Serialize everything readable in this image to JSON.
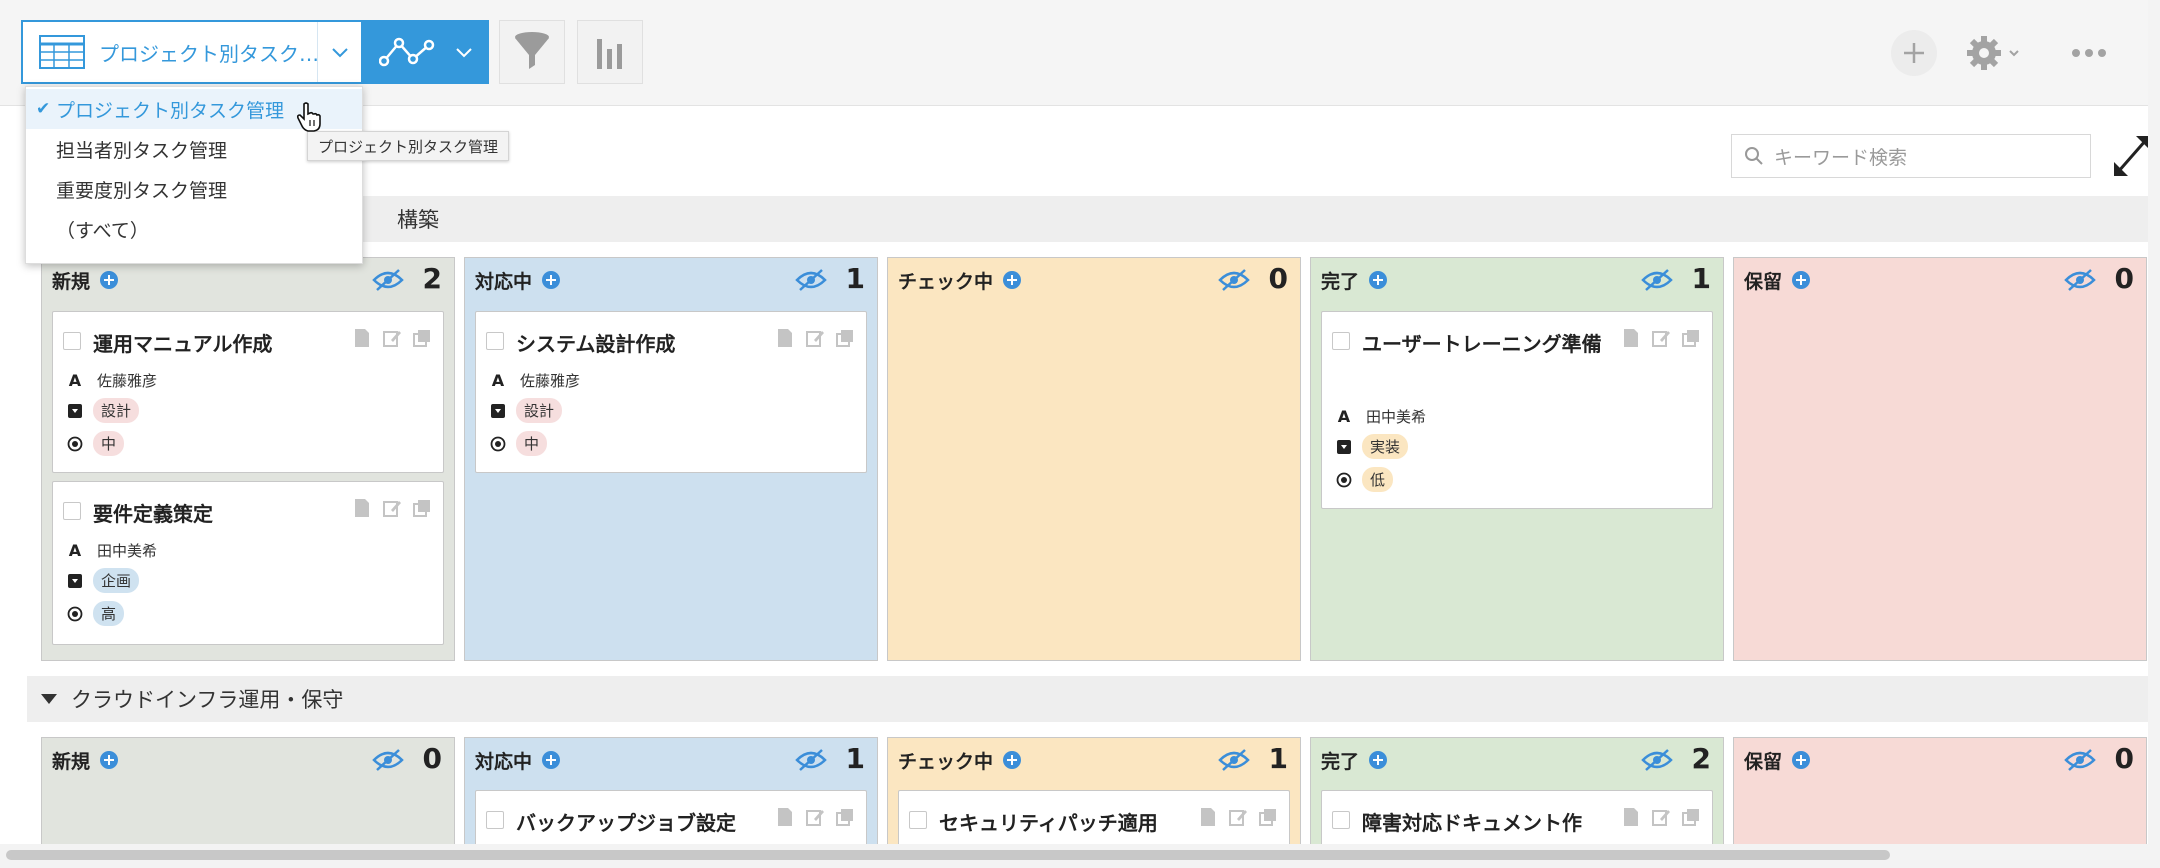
{
  "toolbar": {
    "view_label": "プロジェクト別タスク…",
    "icons": [
      "table-icon",
      "chevron-down-icon",
      "graph-icon",
      "filter-icon",
      "bar-chart-icon",
      "plus-icon",
      "gear-icon",
      "more-icon"
    ]
  },
  "dropdown": {
    "items": [
      {
        "label": "プロジェクト別タスク管理",
        "selected": true
      },
      {
        "label": "担当者別タスク管理",
        "selected": false
      },
      {
        "label": "重要度別タスク管理",
        "selected": false
      },
      {
        "label": "（すべて）",
        "selected": false
      }
    ],
    "tooltip": "プロジェクト別タスク管理"
  },
  "search": {
    "placeholder": "キーワード検索"
  },
  "groups": [
    {
      "title": "構築",
      "columns": [
        {
          "title": "新規",
          "count": "2",
          "color": "#e1e4de",
          "cards": [
            {
              "title": "運用マニュアル作成",
              "assignee": "佐藤雅彦",
              "category": "設計",
              "category_color": "#f6dede",
              "priority": "中",
              "priority_color": "#f6dede"
            },
            {
              "title": "要件定義策定",
              "assignee": "田中美希",
              "category": "企画",
              "category_color": "#cfe2f0",
              "priority": "高",
              "priority_color": "#cfe2f0"
            }
          ]
        },
        {
          "title": "対応中",
          "count": "1",
          "color": "#cde0ef",
          "cards": [
            {
              "title": "システム設計作成",
              "assignee": "佐藤雅彦",
              "category": "設計",
              "category_color": "#f6dede",
              "priority": "中",
              "priority_color": "#f6dede"
            }
          ]
        },
        {
          "title": "チェック中",
          "count": "0",
          "color": "#fbe6c1",
          "cards": []
        },
        {
          "title": "完了",
          "count": "1",
          "color": "#d9e8d3",
          "cards": [
            {
              "title": "ユーザートレーニング準備",
              "assignee": "田中美希",
              "category": "実装",
              "category_color": "#fbe6c1",
              "priority": "低",
              "priority_color": "#fbe6c1"
            }
          ]
        },
        {
          "title": "保留",
          "count": "0",
          "color": "#f7dad6",
          "cards": []
        }
      ]
    },
    {
      "title": "クラウドインフラ運用・保守",
      "columns": [
        {
          "title": "新規",
          "count": "0",
          "color": "#e1e4de",
          "cards": []
        },
        {
          "title": "対応中",
          "count": "1",
          "color": "#cde0ef",
          "cards": [
            {
              "title": "バックアップジョブ設定"
            }
          ]
        },
        {
          "title": "チェック中",
          "count": "1",
          "color": "#fbe6c1",
          "cards": [
            {
              "title": "セキュリティパッチ適用"
            }
          ]
        },
        {
          "title": "完了",
          "count": "2",
          "color": "#d9e8d3",
          "cards": [
            {
              "title": "障害対応ドキュメント作"
            }
          ]
        },
        {
          "title": "保留",
          "count": "0",
          "color": "#f7dad6",
          "cards": []
        }
      ]
    }
  ]
}
